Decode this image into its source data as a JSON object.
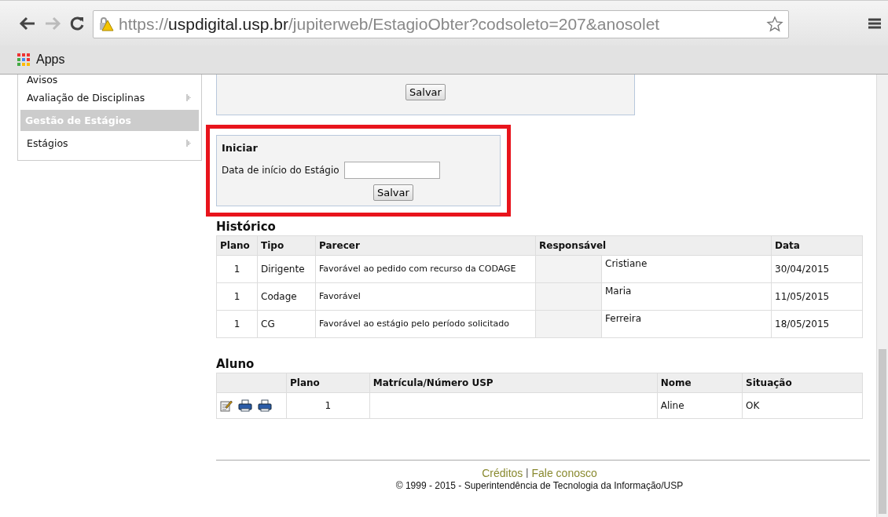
{
  "browser": {
    "url_scheme": "https://",
    "url_host": "uspdigital.usp.br",
    "url_path": "/jupiterweb/EstagioObter?codsoleto=207&anosolet",
    "bookmarks": [
      "Apps"
    ]
  },
  "sidebar": {
    "items": [
      {
        "label": "Avisos",
        "kind": "link",
        "submenu": false
      },
      {
        "label": "Avaliação de Disciplinas",
        "kind": "link",
        "submenu": true
      },
      {
        "label": "Gestão de Estágios",
        "kind": "header",
        "submenu": false
      },
      {
        "label": "Estágios",
        "kind": "link",
        "submenu": true
      }
    ]
  },
  "top_form": {
    "button": "Salvar"
  },
  "iniciar": {
    "title": "Iniciar",
    "highlighted": true,
    "field_label": "Data de início do Estágio",
    "button": "Salvar"
  },
  "historico": {
    "title": "Histórico",
    "columns": [
      "Plano",
      "Tipo",
      "Parecer",
      "Responsável",
      "Data"
    ],
    "rows": [
      {
        "plano": "1",
        "tipo": "Dirigente",
        "parecer": "Favorável ao pedido com recurso da CODAGE",
        "responsavel": "Cristiane",
        "data": "30/04/2015"
      },
      {
        "plano": "1",
        "tipo": "Codage",
        "parecer": "Favorável",
        "responsavel": "Maria",
        "data": "11/05/2015"
      },
      {
        "plano": "1",
        "tipo": "CG",
        "parecer": "Favorável ao estágio pelo período solicitado",
        "responsavel": "Ferreira",
        "data": "18/05/2015"
      }
    ]
  },
  "aluno": {
    "title": "Aluno",
    "columns": [
      "Plano",
      "Matrícula/Número USP",
      "Nome",
      "Situação"
    ],
    "rows": [
      {
        "plano": "1",
        "nome": "Aline",
        "situacao": "OK"
      }
    ]
  },
  "footer": {
    "links": [
      "Créditos",
      "Fale conosco"
    ],
    "separator": "|",
    "copyright": "© 1999 - 2015 - Superintendência de Tecnologia da Informação/USP"
  }
}
